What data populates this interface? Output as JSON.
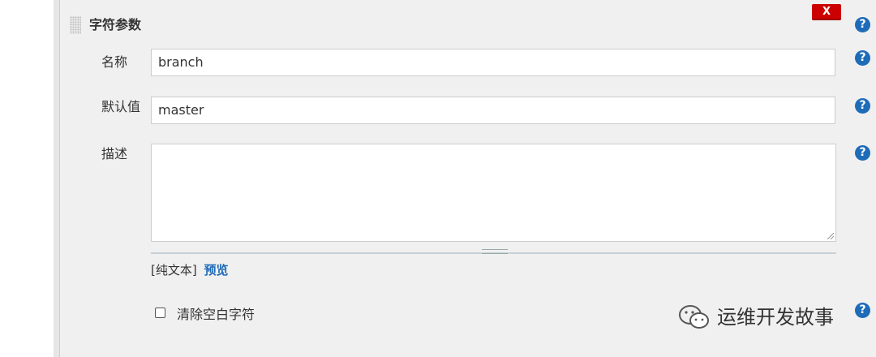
{
  "section": {
    "title": "字符参数",
    "delete_label": "X"
  },
  "fields": {
    "name_label": "名称",
    "name_value": "branch",
    "default_label": "默认值",
    "default_value": "master",
    "description_label": "描述",
    "description_value": ""
  },
  "format": {
    "plain_text": "[纯文本]",
    "preview": "预览"
  },
  "trim": {
    "label": "清除空白字符",
    "checked": false
  },
  "help_symbol": "?",
  "watermark": {
    "text": "运维开发故事",
    "icon": "wechat-icon"
  },
  "colors": {
    "delete_button": "#cc0000",
    "help_icon": "#1e6bb8",
    "link": "#1e6bb8",
    "panel_background": "#f0f0f0"
  }
}
